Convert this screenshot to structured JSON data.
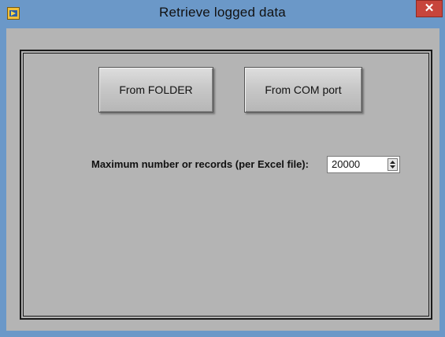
{
  "window": {
    "title": "Retrieve logged data",
    "close_glyph": "✕",
    "app_icon": "labview-app-icon"
  },
  "buttons": {
    "from_folder": "From FOLDER",
    "from_com_port": "From COM port"
  },
  "records": {
    "label": "Maximum number or records (per Excel file):",
    "value": "20000"
  }
}
